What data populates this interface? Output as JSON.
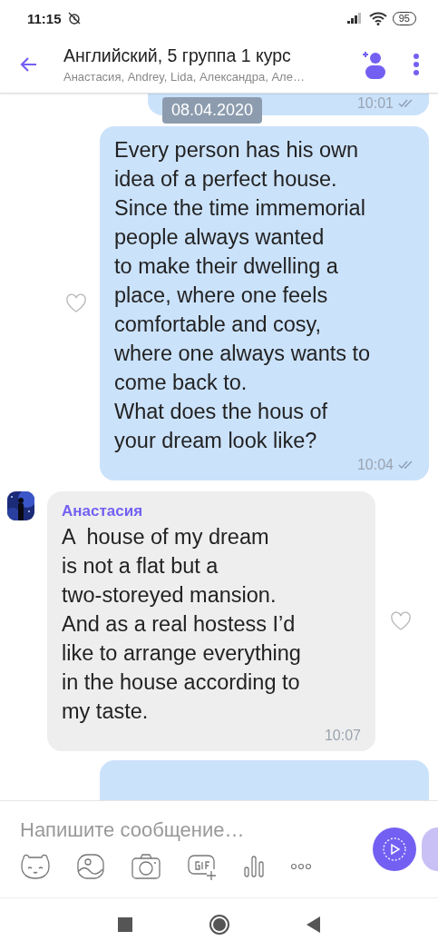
{
  "status_bar": {
    "time": "11:15",
    "battery": "95"
  },
  "header": {
    "title": "Английский, 5 группа 1 курс",
    "subtitle": "Анастасия, Andrey, Lida, Александра, Але…"
  },
  "date_chip": "08.04.2020",
  "messages": [
    {
      "kind": "outgoing",
      "cut_top": true,
      "time": "10:01",
      "read": true
    },
    {
      "kind": "outgoing",
      "text": "Every person has his own\nidea of a perfect house.\nSince the time immemorial\npeople always wanted\nto make their dwelling a\nplace, where one feels\ncomfortable and cosy,\nwhere one always wants to\ncome back to.\nWhat does the hous of\nyour dream look like?",
      "time": "10:04",
      "read": true,
      "liked": false
    },
    {
      "kind": "incoming",
      "sender": "Анастасия",
      "text": "A  house of my dream\nis not a flat but a\ntwo-storeyed mansion.\nAnd as a real hostess I’d\nlike to arrange everything\nin the house according to\nmy taste.",
      "time": "10:07",
      "liked": false
    },
    {
      "kind": "outgoing",
      "cut_bottom": true
    }
  ],
  "composer": {
    "placeholder": "Напишите сообщение…"
  }
}
